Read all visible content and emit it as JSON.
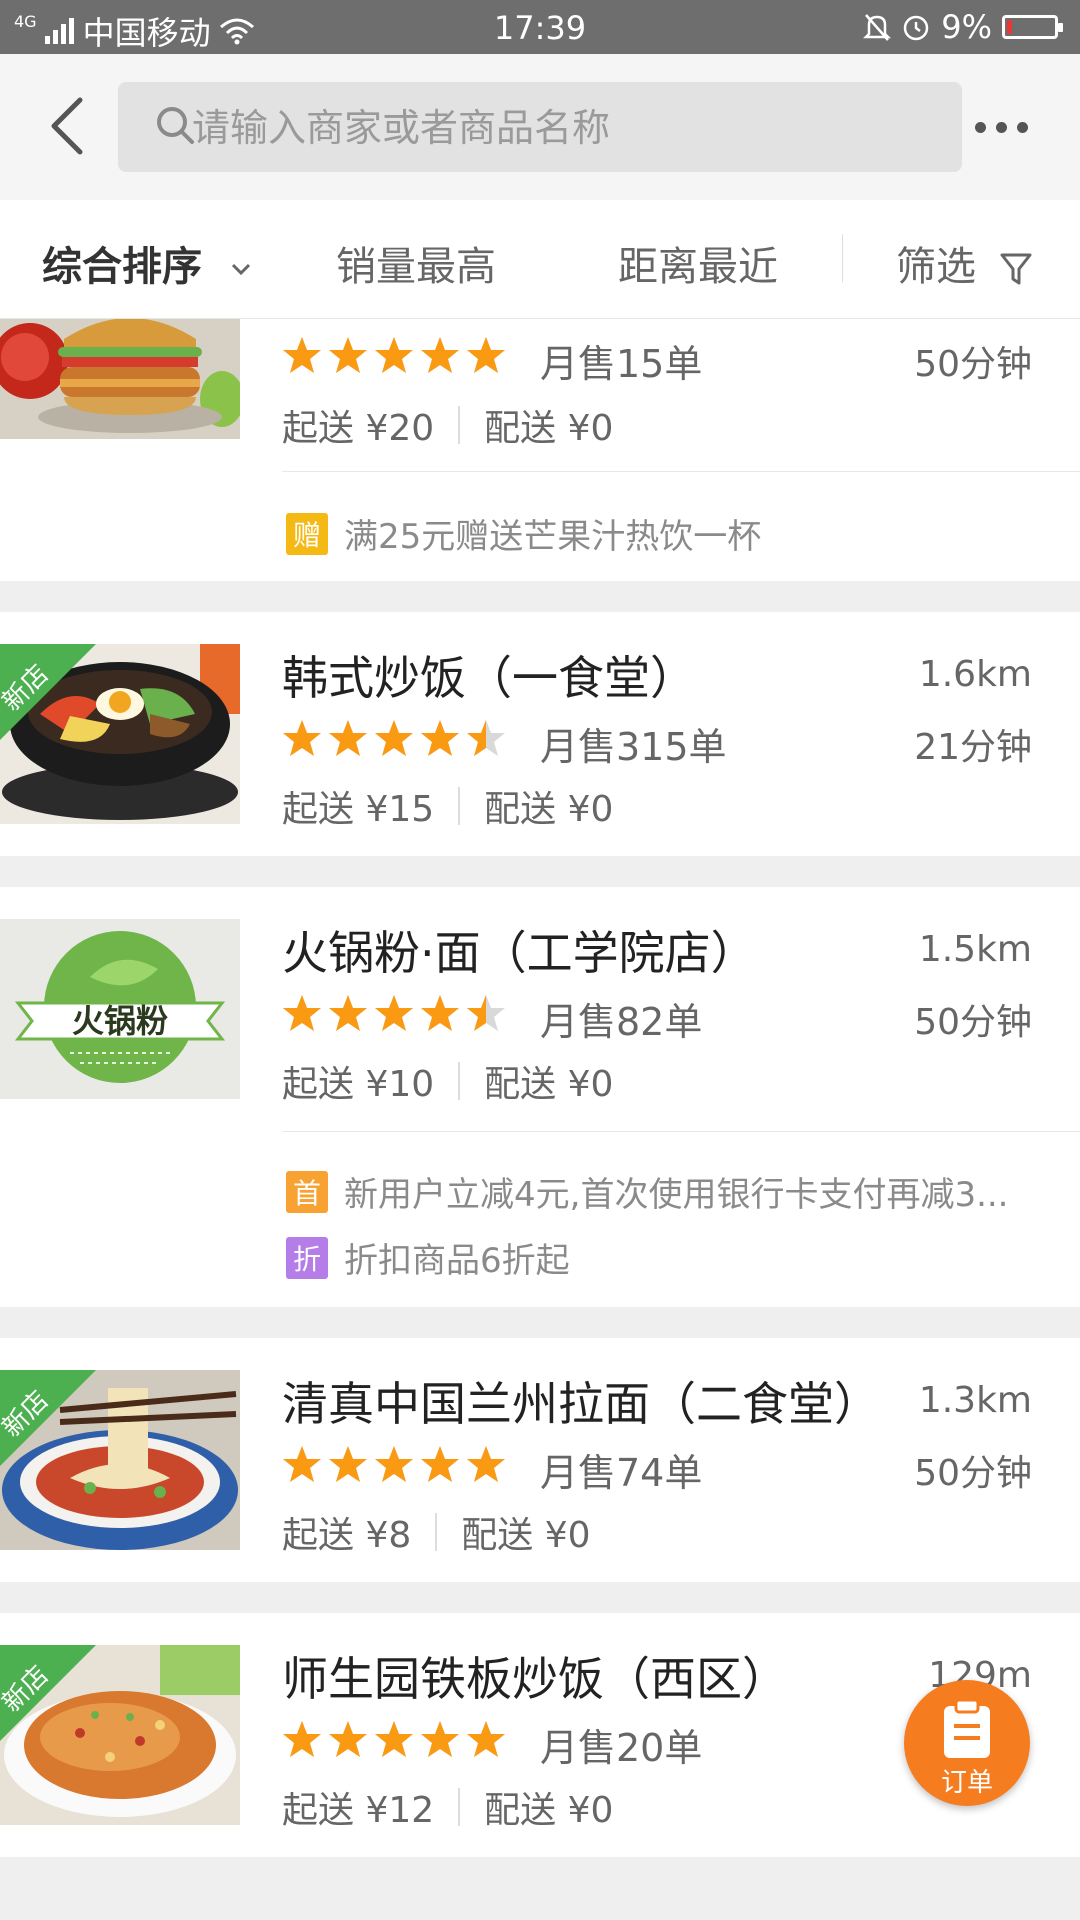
{
  "status_bar": {
    "network": "4G",
    "carrier": "中国移动",
    "time": "17:39",
    "battery": "9%"
  },
  "search": {
    "placeholder": "请输入商家或者商品名称",
    "value": ""
  },
  "sort_tabs": {
    "composite": "综合排序",
    "sales": "销量最高",
    "distance": "距离最近",
    "filter": "筛选"
  },
  "colors": {
    "accent": "#f57c1f",
    "star": "#fa9a13",
    "new_badge": "#4caf50",
    "gift_tag": "#f5b915",
    "first_tag": "#f8a233",
    "discount_tag": "#b57de8"
  },
  "shops": [
    {
      "name": "",
      "rating": 5,
      "monthly_sales": "月售15单",
      "distance": "",
      "delivery_time": "50分钟",
      "min_order": "起送 ¥20",
      "delivery_fee": "配送 ¥0",
      "is_new": false,
      "promos": [
        {
          "tag": "赠",
          "color": "gift_tag",
          "text": "满25元赠送芒果汁热饮一杯"
        }
      ]
    },
    {
      "name": "韩式炒饭（一食堂）",
      "rating": 4.5,
      "monthly_sales": "月售315单",
      "distance": "1.6km",
      "delivery_time": "21分钟",
      "min_order": "起送 ¥15",
      "delivery_fee": "配送 ¥0",
      "is_new": true,
      "new_label": "新店",
      "promos": []
    },
    {
      "name": "火锅粉·面（工学院店）",
      "rating": 4.5,
      "monthly_sales": "月售82单",
      "distance": "1.5km",
      "delivery_time": "50分钟",
      "min_order": "起送 ¥10",
      "delivery_fee": "配送 ¥0",
      "is_new": false,
      "logo_text": "火锅粉",
      "promos": [
        {
          "tag": "首",
          "color": "first_tag",
          "text": "新用户立减4元,首次使用银行卡支付再减3..."
        },
        {
          "tag": "折",
          "color": "discount_tag",
          "text": "折扣商品6折起"
        }
      ]
    },
    {
      "name": "清真中国兰州拉面（二食堂）",
      "rating": 5,
      "monthly_sales": "月售74单",
      "distance": "1.3km",
      "delivery_time": "50分钟",
      "min_order": "起送 ¥8",
      "delivery_fee": "配送 ¥0",
      "is_new": true,
      "new_label": "新店",
      "promos": []
    },
    {
      "name": "师生园铁板炒饭（西区）",
      "rating": 5,
      "monthly_sales": "月售20单",
      "distance": "129m",
      "delivery_time": "",
      "min_order": "起送 ¥12",
      "delivery_fee": "配送 ¥0",
      "is_new": true,
      "new_label": "新店",
      "promos": []
    }
  ],
  "order_button": {
    "label": "订单"
  }
}
